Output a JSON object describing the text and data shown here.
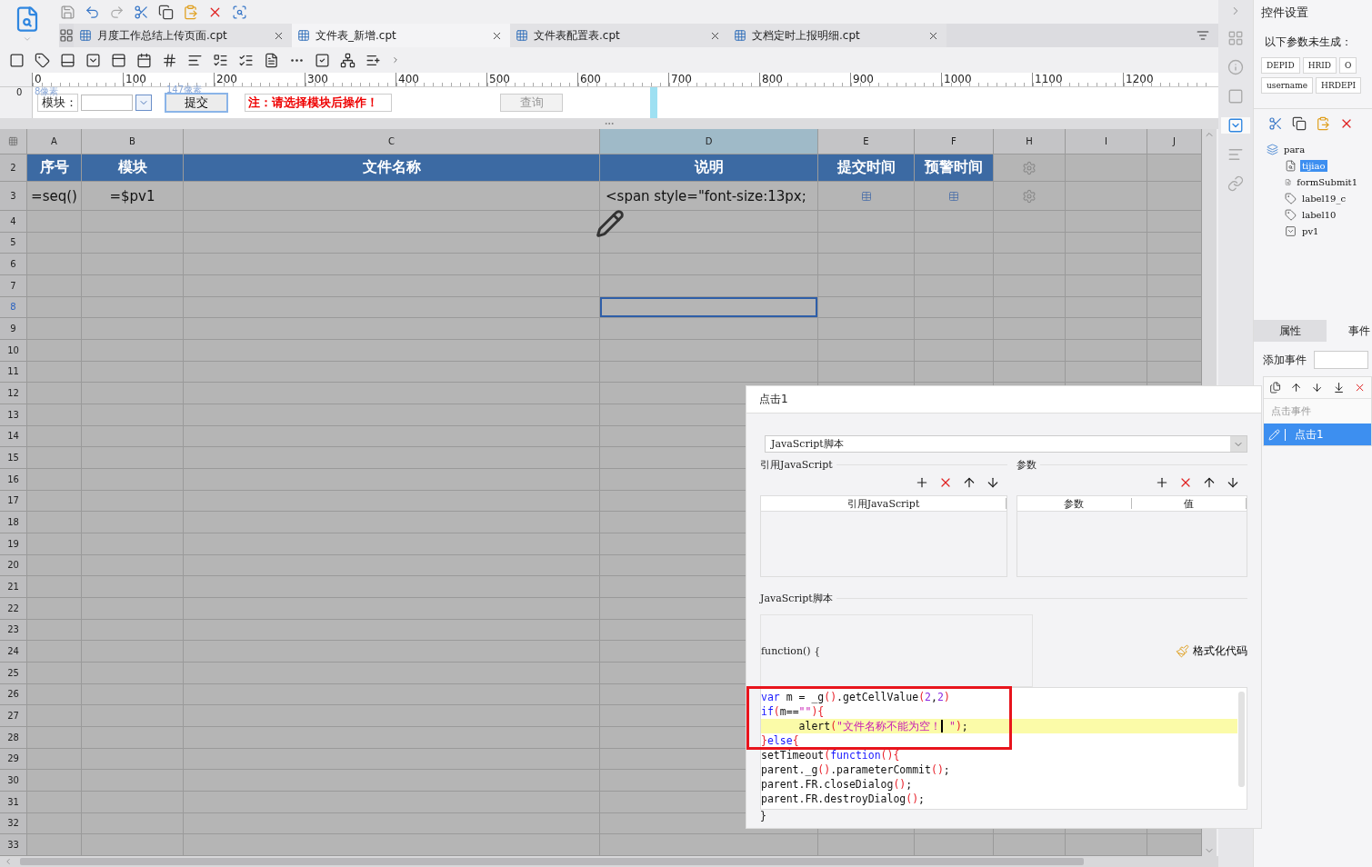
{
  "tabs": [
    {
      "label": "月度工作总结上传页面.cpt",
      "selected": false
    },
    {
      "label": "文件表_新增.cpt",
      "selected": true
    },
    {
      "label": "文件表配置表.cpt",
      "selected": false
    },
    {
      "label": "文档定时上报明细.cpt",
      "selected": false
    }
  ],
  "ruler": {
    "ticks": [
      "0",
      "100",
      "200",
      "300",
      "400",
      "500",
      "600",
      "700",
      "800",
      "900",
      "1000",
      "1100",
      "1200"
    ],
    "side_mark": "0"
  },
  "param_panel": {
    "size_hints": [
      "8像素",
      "147像素"
    ],
    "label": "模块：",
    "submit": "提交",
    "note": "注：请选择模块后操作！",
    "query": {
      "label": "查询",
      "disabled": true
    }
  },
  "sheet": {
    "columns": [
      {
        "label": "A",
        "selected": false
      },
      {
        "label": "B",
        "selected": false
      },
      {
        "label": "C",
        "selected": false
      },
      {
        "label": "D",
        "selected": true
      },
      {
        "label": "E",
        "selected": false
      },
      {
        "label": "F",
        "selected": false
      },
      {
        "label": "H",
        "selected": false
      },
      {
        "label": "I",
        "selected": false
      },
      {
        "label": "J",
        "selected": false
      }
    ],
    "rows": [
      {
        "label": "2",
        "kind": "header",
        "selected": false,
        "cells": [
          "序号",
          "模块",
          "文件名称",
          "说明",
          "提交时间",
          "预警时间"
        ]
      },
      {
        "label": "3",
        "kind": "data",
        "selected": false,
        "cells": [
          "=seq()",
          "=$pv1",
          null,
          "<span style=\"font-size:13px;"
        ]
      },
      {
        "label": "4",
        "kind": "empty",
        "selected": false
      },
      {
        "label": "5",
        "kind": "empty",
        "selected": false
      },
      {
        "label": "6",
        "kind": "empty",
        "selected": false
      },
      {
        "label": "7",
        "kind": "empty",
        "selected": false
      },
      {
        "label": "8",
        "kind": "empty",
        "selected": true
      },
      {
        "label": "9",
        "kind": "empty",
        "selected": false
      },
      {
        "label": "10",
        "kind": "empty",
        "selected": false
      },
      {
        "label": "11",
        "kind": "empty",
        "selected": false
      },
      {
        "label": "12",
        "kind": "empty",
        "selected": false
      },
      {
        "label": "13",
        "kind": "empty",
        "selected": false
      },
      {
        "label": "14",
        "kind": "empty",
        "selected": false
      },
      {
        "label": "15",
        "kind": "empty",
        "selected": false
      },
      {
        "label": "16",
        "kind": "empty",
        "selected": false
      },
      {
        "label": "17",
        "kind": "empty",
        "selected": false
      },
      {
        "label": "18",
        "kind": "empty",
        "selected": false
      },
      {
        "label": "19",
        "kind": "empty",
        "selected": false
      },
      {
        "label": "20",
        "kind": "empty",
        "selected": false
      },
      {
        "label": "21",
        "kind": "empty",
        "selected": false
      },
      {
        "label": "22",
        "kind": "empty",
        "selected": false
      },
      {
        "label": "23",
        "kind": "empty",
        "selected": false
      },
      {
        "label": "24",
        "kind": "empty",
        "selected": false
      },
      {
        "label": "25",
        "kind": "empty",
        "selected": false
      },
      {
        "label": "26",
        "kind": "empty",
        "selected": false
      },
      {
        "label": "27",
        "kind": "empty",
        "selected": false
      },
      {
        "label": "28",
        "kind": "empty",
        "selected": false
      },
      {
        "label": "29",
        "kind": "empty",
        "selected": false
      },
      {
        "label": "30",
        "kind": "empty",
        "selected": false
      },
      {
        "label": "31",
        "kind": "empty",
        "selected": false
      },
      {
        "label": "32",
        "kind": "empty",
        "selected": false
      },
      {
        "label": "33",
        "kind": "empty",
        "selected": false
      }
    ]
  },
  "dialog": {
    "title": "点击1",
    "script_type": "JavaScript脚本",
    "ref_section": "引用JavaScript",
    "ref_columns": [
      "引用JavaScript"
    ],
    "param_section": "参数",
    "param_columns": [
      "参数",
      "值"
    ],
    "script_section": "JavaScript脚本",
    "function_head": "function() {",
    "format_button": "格式化代码",
    "code": [
      {
        "highlight": false,
        "tokens": [
          {
            "kind": "keyword",
            "text": "var"
          },
          {
            "kind": "plain",
            "text": " m = _g"
          },
          {
            "kind": "paren",
            "text": "()"
          },
          {
            "kind": "plain",
            "text": ".getCellValue"
          },
          {
            "kind": "paren",
            "text": "("
          },
          {
            "kind": "number",
            "text": "2"
          },
          {
            "kind": "plain",
            "text": ","
          },
          {
            "kind": "number",
            "text": "2"
          },
          {
            "kind": "paren",
            "text": ")"
          }
        ]
      },
      {
        "highlight": false,
        "tokens": [
          {
            "kind": "keyword",
            "text": "if"
          },
          {
            "kind": "paren",
            "text": "("
          },
          {
            "kind": "plain",
            "text": "m=="
          },
          {
            "kind": "string",
            "text": "\"\""
          },
          {
            "kind": "paren",
            "text": "){"
          }
        ]
      },
      {
        "highlight": true,
        "tokens": [
          {
            "kind": "plain",
            "text": "      alert"
          },
          {
            "kind": "paren",
            "text": "("
          },
          {
            "kind": "string",
            "text": "\"文件名称不能为空！"
          },
          {
            "kind": "cursor"
          },
          {
            "kind": "string",
            "text": " \""
          },
          {
            "kind": "paren",
            "text": ")"
          },
          {
            "kind": "plain",
            "text": ";"
          }
        ]
      },
      {
        "highlight": false,
        "tokens": [
          {
            "kind": "paren",
            "text": "}"
          },
          {
            "kind": "keyword",
            "text": "else"
          },
          {
            "kind": "paren",
            "text": "{"
          }
        ]
      },
      {
        "highlight": false,
        "tokens": [
          {
            "kind": "plain",
            "text": "setTimeout"
          },
          {
            "kind": "paren",
            "text": "("
          },
          {
            "kind": "keyword",
            "text": "function"
          },
          {
            "kind": "paren",
            "text": "(){"
          }
        ]
      },
      {
        "highlight": false,
        "tokens": [
          {
            "kind": "plain",
            "text": "parent._g"
          },
          {
            "kind": "paren",
            "text": "()"
          },
          {
            "kind": "plain",
            "text": ".parameterCommit"
          },
          {
            "kind": "paren",
            "text": "()"
          },
          {
            "kind": "plain",
            "text": ";"
          }
        ]
      },
      {
        "highlight": false,
        "tokens": [
          {
            "kind": "plain",
            "text": "parent.FR.closeDialog"
          },
          {
            "kind": "paren",
            "text": "()"
          },
          {
            "kind": "plain",
            "text": ";"
          }
        ]
      },
      {
        "highlight": false,
        "tokens": [
          {
            "kind": "plain",
            "text": "parent.FR.destroyDialog"
          },
          {
            "kind": "paren",
            "text": "()"
          },
          {
            "kind": "plain",
            "text": ";"
          }
        ]
      }
    ],
    "function_tail": "}"
  },
  "side_panel": {
    "title": "控件设置",
    "notice": "以下参数未生成：",
    "params": [
      "DEPID",
      "HRID",
      "O",
      "username",
      "HRDEPI"
    ],
    "tree": [
      {
        "label": "para",
        "kind": "group",
        "selected": false,
        "children": [
          {
            "label": "tijiao",
            "kind": "button",
            "selected": true
          },
          {
            "label": "formSubmit1",
            "kind": "button",
            "selected": false
          },
          {
            "label": "label19_c",
            "kind": "label",
            "selected": false
          },
          {
            "label": "label10",
            "kind": "label",
            "selected": false
          },
          {
            "label": "pv1",
            "kind": "combo",
            "selected": false
          }
        ]
      }
    ],
    "tabs": [
      {
        "label": "属性",
        "selected": false
      },
      {
        "label": "事件",
        "selected": true
      }
    ],
    "add_event": "添加事件",
    "event_groups": [
      {
        "label": "点击事件",
        "items": [
          {
            "label": "点击1",
            "selected": true
          }
        ]
      }
    ]
  }
}
